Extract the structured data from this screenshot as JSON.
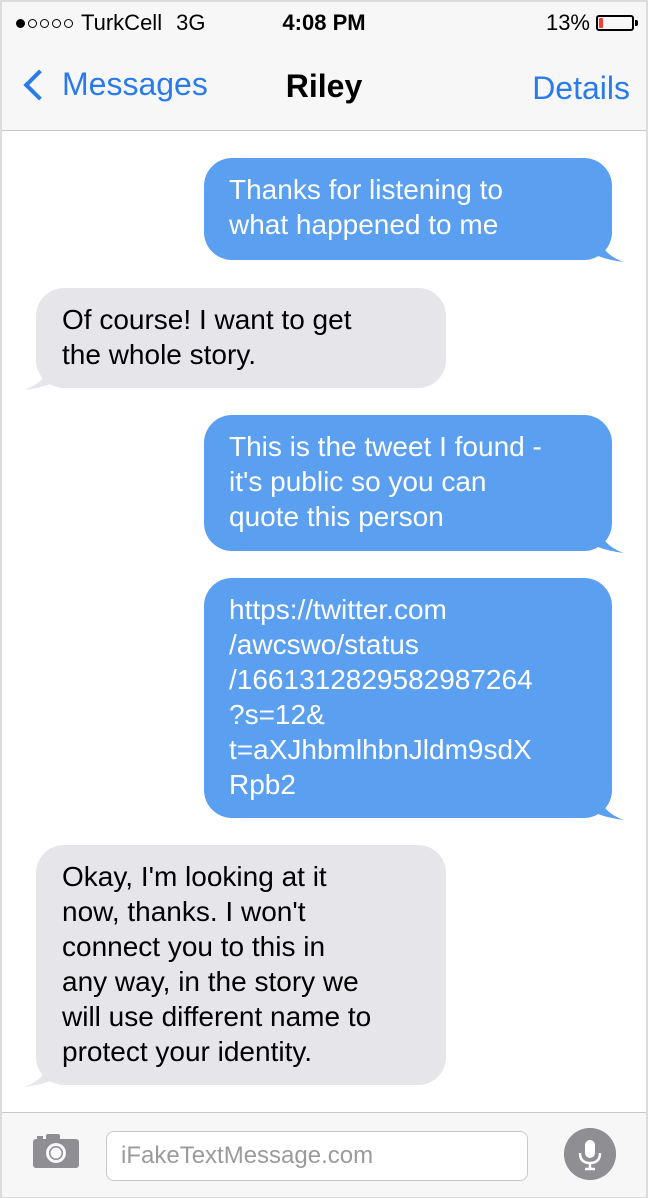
{
  "status_bar": {
    "signal_bars_filled": 1,
    "signal_bars_total": 5,
    "carrier": "TurkCell",
    "network": "3G",
    "time": "4:08 PM",
    "battery_percent": "13%",
    "battery_level": 0.13,
    "battery_color": "#ff3b30"
  },
  "nav": {
    "back_label": "Messages",
    "title": "Riley",
    "details_label": "Details",
    "accent_color": "#2a7bea"
  },
  "messages": [
    {
      "direction": "sent",
      "lines": [
        "Thanks for listening to",
        "what happened to me"
      ]
    },
    {
      "direction": "received",
      "lines": [
        "Of course! I want to get",
        "the whole story."
      ]
    },
    {
      "direction": "sent",
      "lines": [
        "This is the tweet I found -",
        "it's public so you can",
        "quote this person"
      ]
    },
    {
      "direction": "sent",
      "lines": [
        "https://twitter.com",
        "/awcswo/status",
        "/1661312829582987264",
        "?s=12&",
        "t=aXJhbmlhbnJldm9sdX",
        "Rpb2"
      ]
    },
    {
      "direction": "received",
      "lines": [
        "Okay, I'm looking at it",
        "now, thanks. I won't",
        "connect you to this in",
        "any way, in the story we",
        "will use different name to",
        "protect your identity."
      ]
    }
  ],
  "composer": {
    "camera_icon": "camera-icon",
    "input_placeholder": "iFakeTextMessage.com",
    "mic_icon": "microphone-icon"
  },
  "colors": {
    "sent_bubble": "#5a9ff0",
    "received_bubble": "#e5e5ea"
  }
}
